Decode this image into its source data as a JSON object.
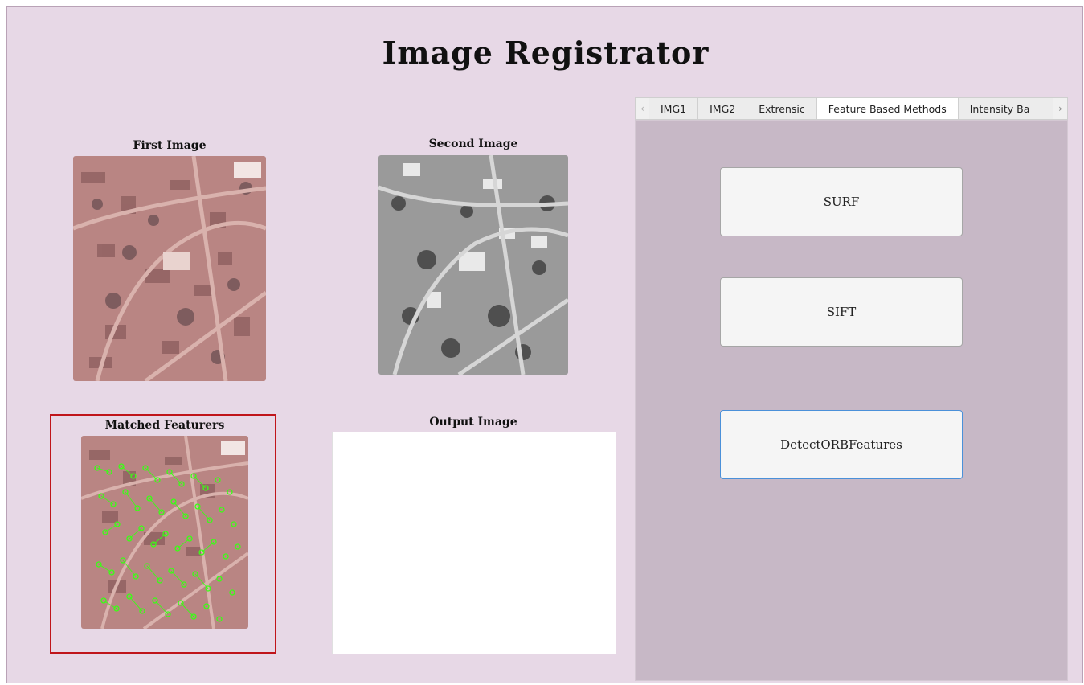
{
  "app": {
    "title": "Image Registrator"
  },
  "images": {
    "first_label": "First Image",
    "second_label": "Second Image",
    "matched_label": "Matched Featurers",
    "output_label": "Output Image"
  },
  "tabs": {
    "items": [
      {
        "label": "IMG1"
      },
      {
        "label": "IMG2"
      },
      {
        "label": "Extrensic"
      },
      {
        "label": "Feature Based Methods"
      },
      {
        "label": "Intensity Ba"
      }
    ],
    "active": "Feature Based Methods",
    "left_arrow": "‹",
    "right_arrow": "›"
  },
  "buttons": {
    "surf": "SURF",
    "sift": "SIFT",
    "orb": "DetectORBFeatures"
  },
  "colors": {
    "background": "#e7d8e6",
    "panel": "#c7b8c6",
    "highlight_frame": "#c0151b",
    "feature_markers": "#39ff14"
  }
}
